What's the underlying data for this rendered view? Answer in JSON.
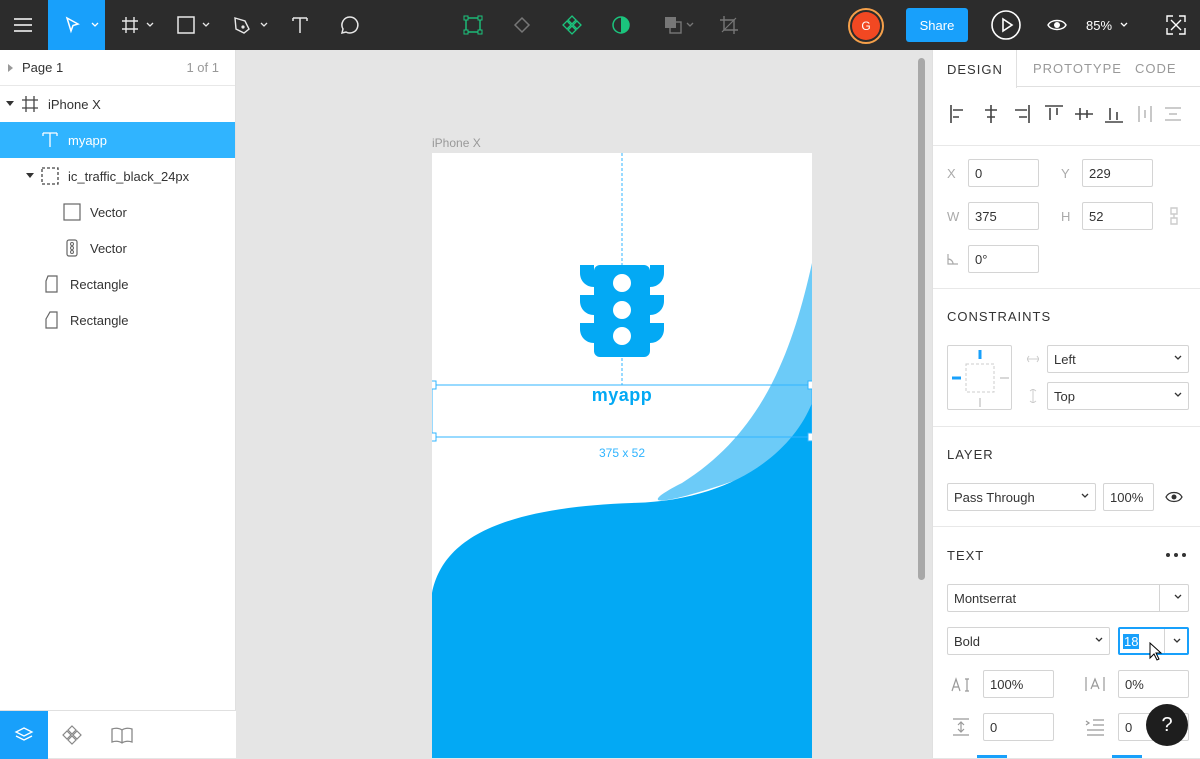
{
  "toolbar": {
    "share_label": "Share",
    "zoom": "85%",
    "avatar_initial": "G"
  },
  "pages": {
    "current": "Page 1",
    "count": "1 of 1"
  },
  "layers": [
    {
      "name": "iPhone X",
      "icon": "frame-icon"
    },
    {
      "name": "myapp",
      "icon": "text-icon"
    },
    {
      "name": "ic_traffic_black_24px",
      "icon": "group-icon"
    },
    {
      "name": "Vector",
      "icon": "vector-square-icon"
    },
    {
      "name": "Vector",
      "icon": "traffic-vector-icon"
    },
    {
      "name": "Rectangle",
      "icon": "rectangle-shape-icon"
    },
    {
      "name": "Rectangle",
      "icon": "rectangle-shape-icon"
    }
  ],
  "canvas": {
    "frame_label": "iPhone X",
    "app_text": "myapp",
    "size_label": "375 x 52",
    "accent": "#03a9f4"
  },
  "panel": {
    "tabs": [
      "DESIGN",
      "PROTOTYPE",
      "CODE"
    ],
    "x_label": "X",
    "x": "0",
    "y_label": "Y",
    "y": "229",
    "w_label": "W",
    "w": "375",
    "h_label": "H",
    "h": "52",
    "rotation": "0°",
    "constraints_title": "CONSTRAINTS",
    "constraint_h": "Left",
    "constraint_v": "Top",
    "layer_title": "LAYER",
    "blend": "Pass Through",
    "opacity": "100%",
    "text_title": "TEXT",
    "font_family": "Montserrat",
    "font_weight": "Bold",
    "font_size": "18",
    "line_height": "100%",
    "letter_spacing": "0%",
    "paragraph_spacing": "0",
    "paragraph_indent": "0"
  },
  "help_label": "?"
}
